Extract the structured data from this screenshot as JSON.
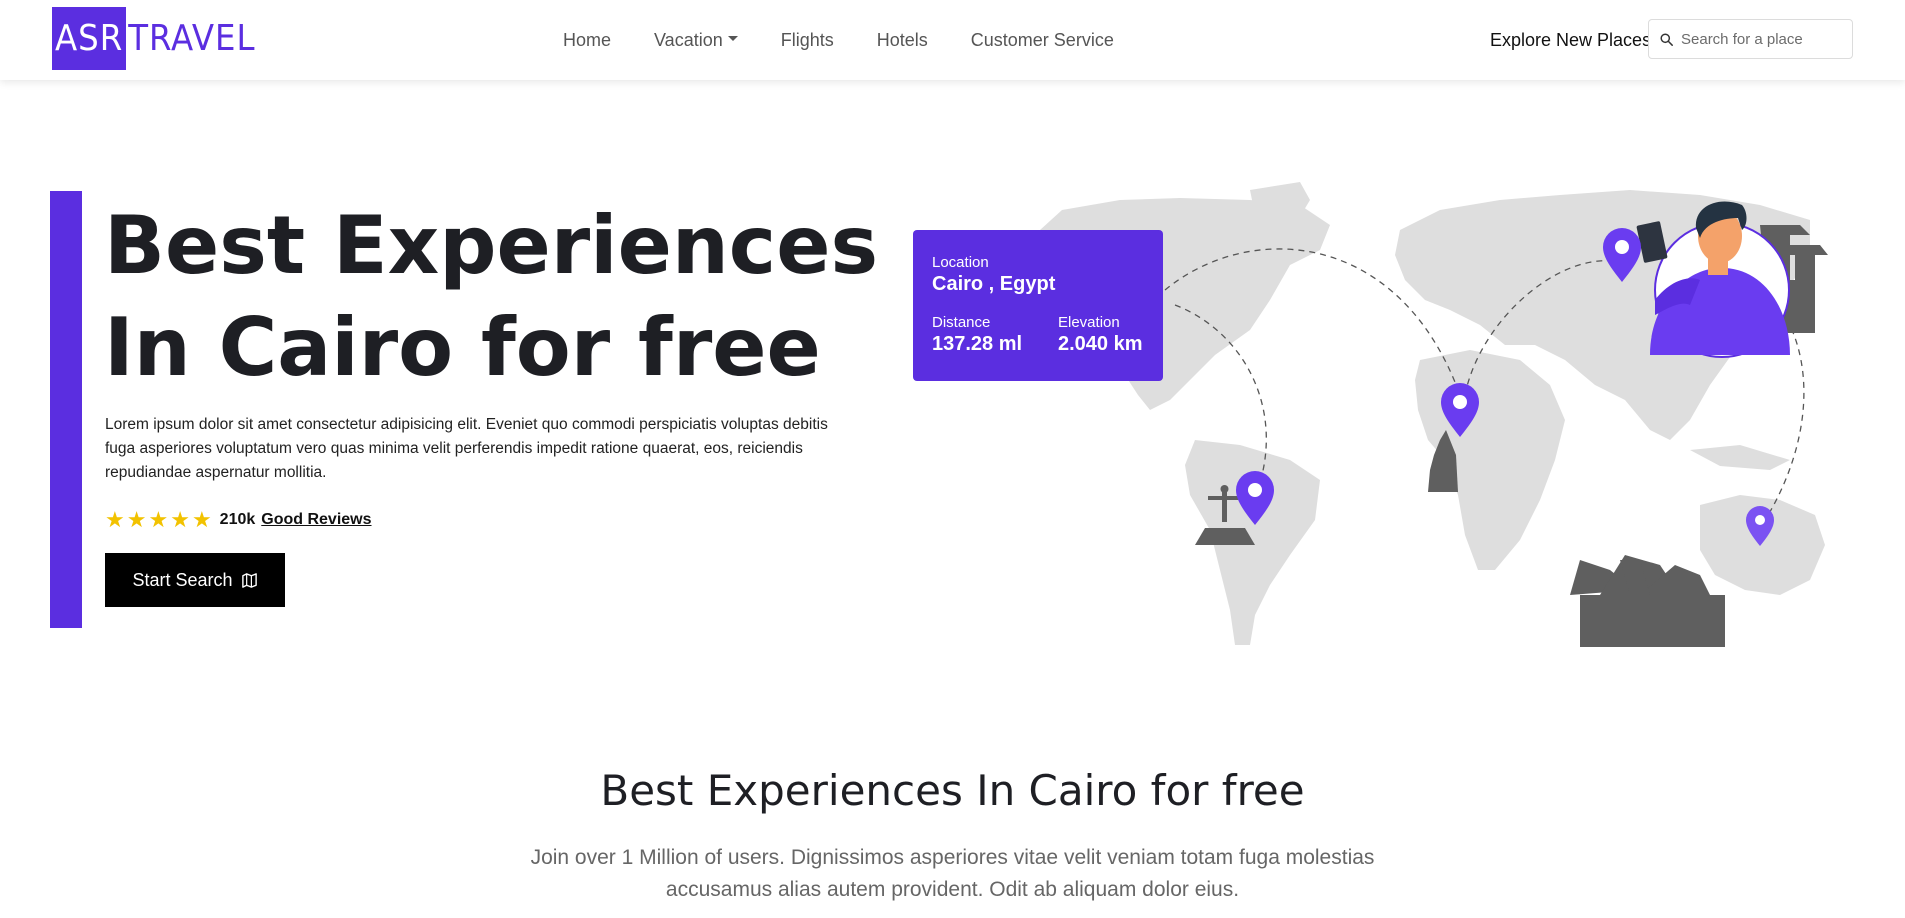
{
  "brand": {
    "logo_box": "ASR",
    "logo_rest": "TRAVEL"
  },
  "nav": {
    "links": [
      "Home",
      "Vacation",
      "Flights",
      "Hotels",
      "Customer Service"
    ],
    "explore_label": "Explore New Places",
    "search_placeholder": "Search for a place"
  },
  "hero": {
    "title_line1": "Best Experiences",
    "title_line2": "In Cairo for free",
    "text": "Lorem ipsum dolor sit amet consectetur adipisicing elit. Eveniet quo commodi perspiciatis voluptas debitis fuga asperiores voluptatum vero quas minima velit perferendis impedit ratione quaerat, eos, reiciendis repudiandae aspernatur mollitia.",
    "rating_stars": 5,
    "rating_count": "210k",
    "rating_link": "Good Reviews",
    "button_label": "Start Search"
  },
  "location_card": {
    "location_label": "Location",
    "location_value": "Cairo , Egypt",
    "distance_label": "Distance",
    "distance_value": "137.28 ml",
    "elevation_label": "Elevation",
    "elevation_value": "2.040 km"
  },
  "section": {
    "title": "Best Experiences In Cairo for free",
    "text": "Join over 1 Million of users. Dignissimos asperiores vitae velit veniam totam fuga molestias accusamus alias autem provident. Odit ab aliquam dolor eius."
  },
  "colors": {
    "accent": "#5b2ee0",
    "star": "#f2c200",
    "map_land": "#dedede",
    "landmark": "#5f5f5f"
  },
  "icons": [
    "search-icon",
    "map-icon",
    "star-icon",
    "map-pin-icon",
    "chevron-down-icon"
  ]
}
